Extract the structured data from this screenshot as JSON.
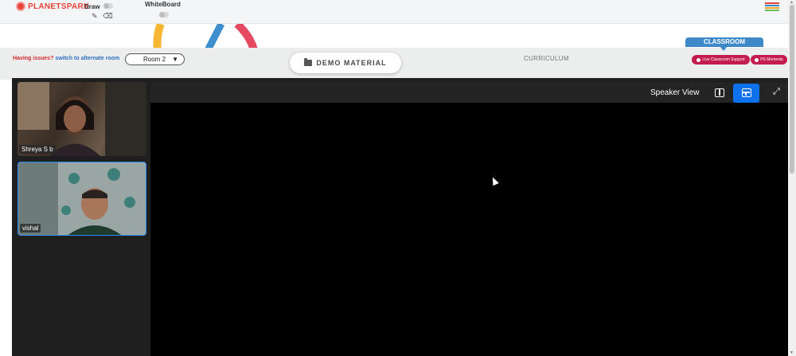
{
  "app": {
    "logo_text": "PLANETSPARK"
  },
  "toolbar": {
    "draw_label": "Draw",
    "whiteboard_label": "WhiteBoard",
    "pencil_icon": "pencil-icon",
    "eraser_icon": "eraser-icon"
  },
  "header": {
    "issues_text": "Having issues?",
    "alternate_link": "switch to alternate room",
    "room_value": "Room 2",
    "demo_material_label": "DEMO MATERIAL",
    "curriculum_label": "CURRICULUM",
    "classroom_tab": "CLASSROOM",
    "live_support_label": "Live Classroom Support",
    "ps_moments_label": "PS Moments"
  },
  "participants": [
    {
      "name": "Shreya S b"
    },
    {
      "name": "vishal"
    }
  ],
  "meeting": {
    "view_label": "Speaker View"
  },
  "colors": {
    "brand_red": "#e8443a",
    "accent_blue": "#0e72ed",
    "classroom_blue": "#3f89c9",
    "support_pill": "#c41c4e"
  }
}
